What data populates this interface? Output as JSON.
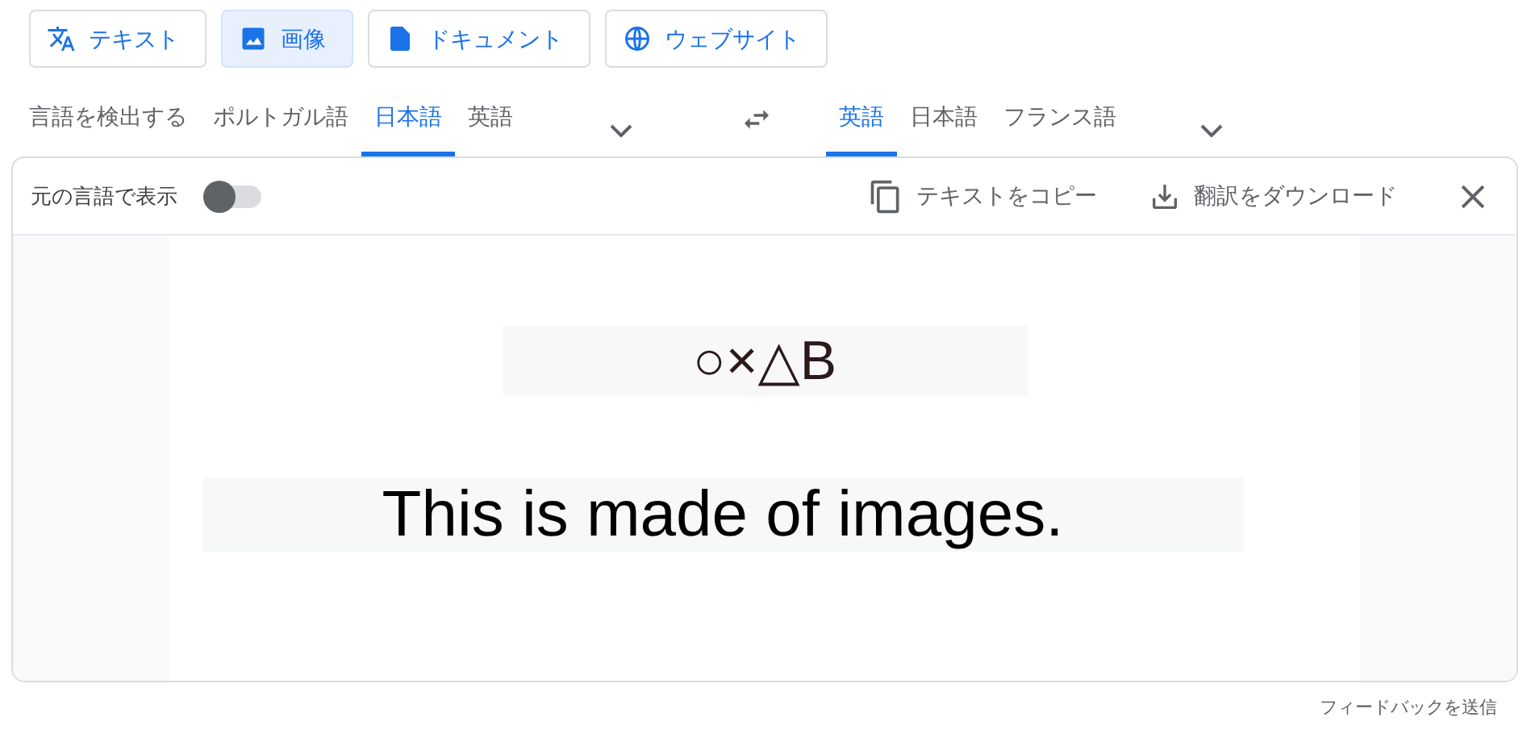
{
  "modes": [
    {
      "label": "テキスト",
      "kind": "text",
      "selected": false
    },
    {
      "label": "画像",
      "kind": "image",
      "selected": true
    },
    {
      "label": "ドキュメント",
      "kind": "document",
      "selected": false
    },
    {
      "label": "ウェブサイト",
      "kind": "website",
      "selected": false
    }
  ],
  "source_languages": [
    {
      "label": "言語を検出する",
      "selected": false
    },
    {
      "label": "ポルトガル語",
      "selected": false
    },
    {
      "label": "日本語",
      "selected": true
    },
    {
      "label": "英語",
      "selected": false
    }
  ],
  "target_languages": [
    {
      "label": "英語",
      "selected": true
    },
    {
      "label": "日本語",
      "selected": false
    },
    {
      "label": "フランス語",
      "selected": false
    }
  ],
  "toolbar": {
    "show_original_label": "元の言語で表示",
    "show_original_on": false,
    "copy_label": "テキストをコピー",
    "download_label": "翻訳をダウンロード"
  },
  "translated_image": {
    "lines": [
      "○×△B",
      "This is made of images."
    ]
  },
  "feedback_link": "フィードバックを送信"
}
